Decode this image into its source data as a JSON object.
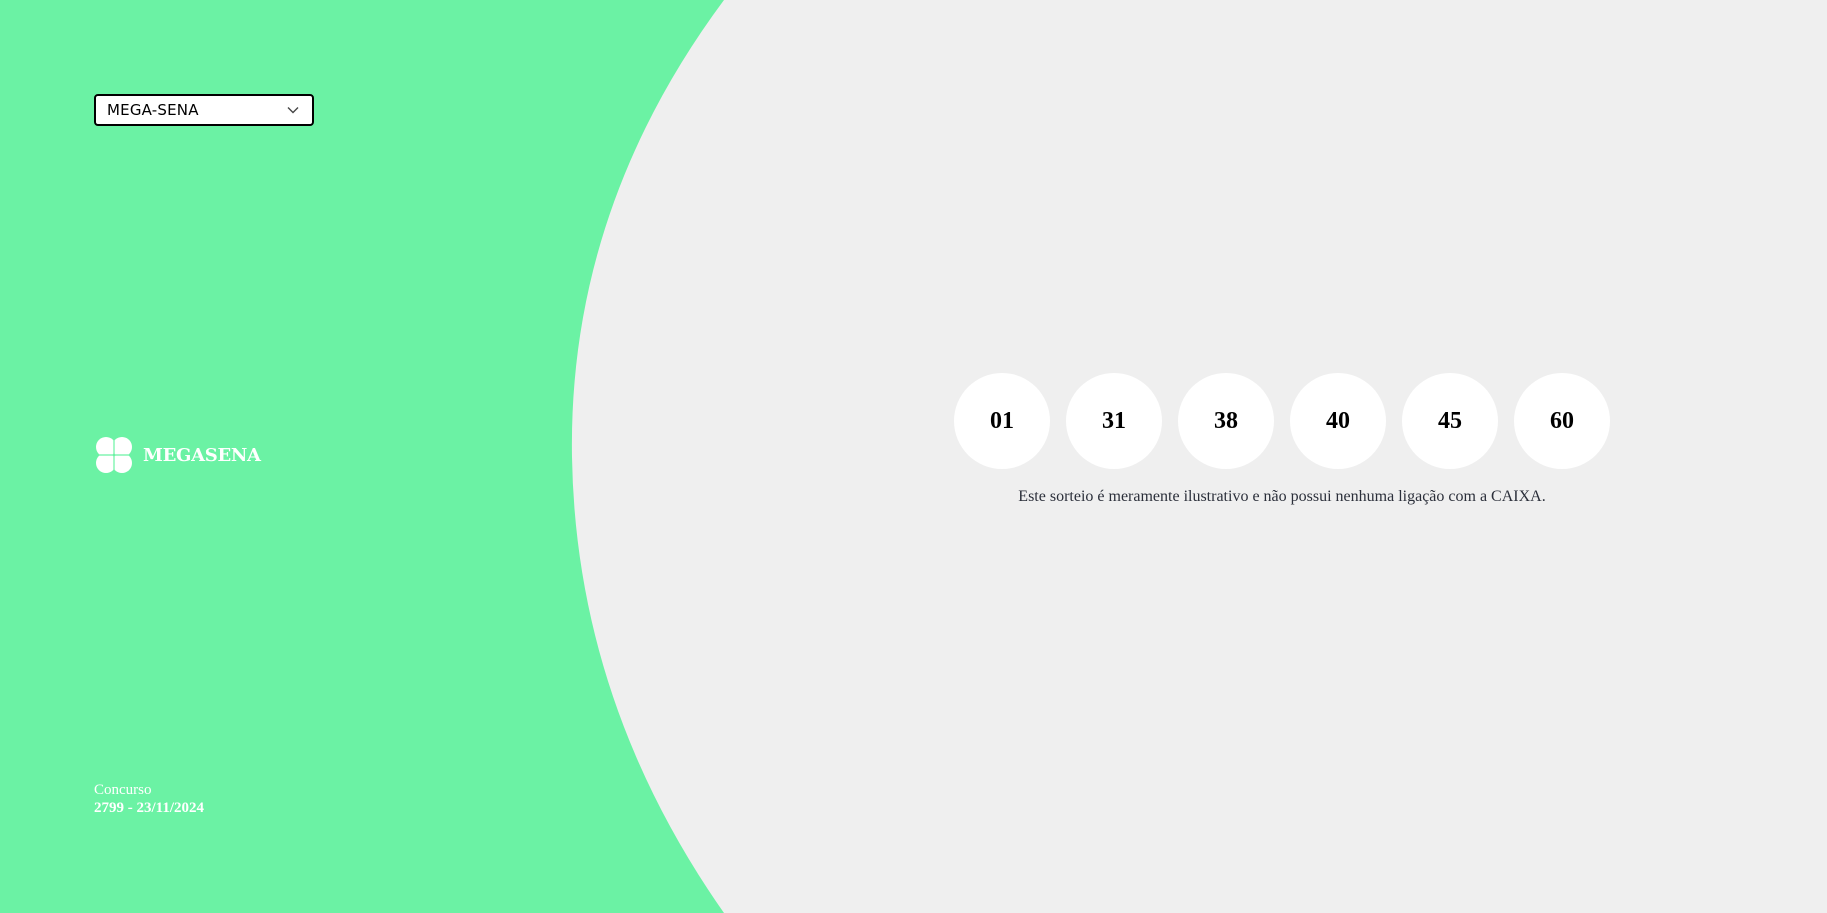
{
  "lottery_select": {
    "value": "MEGA-SENA"
  },
  "logo": {
    "text": "MEGASENA",
    "icon": "clover-icon"
  },
  "contest": {
    "label": "Concurso",
    "value": "2799 - 23/11/2024"
  },
  "drawn_numbers": [
    "01",
    "31",
    "38",
    "40",
    "45",
    "60"
  ],
  "disclaimer": "Este sorteio é meramente ilustrativo e não possui nenhuma ligação com a CAIXA.",
  "colors": {
    "accent": "#6bef a3",
    "background": "#efefef"
  }
}
